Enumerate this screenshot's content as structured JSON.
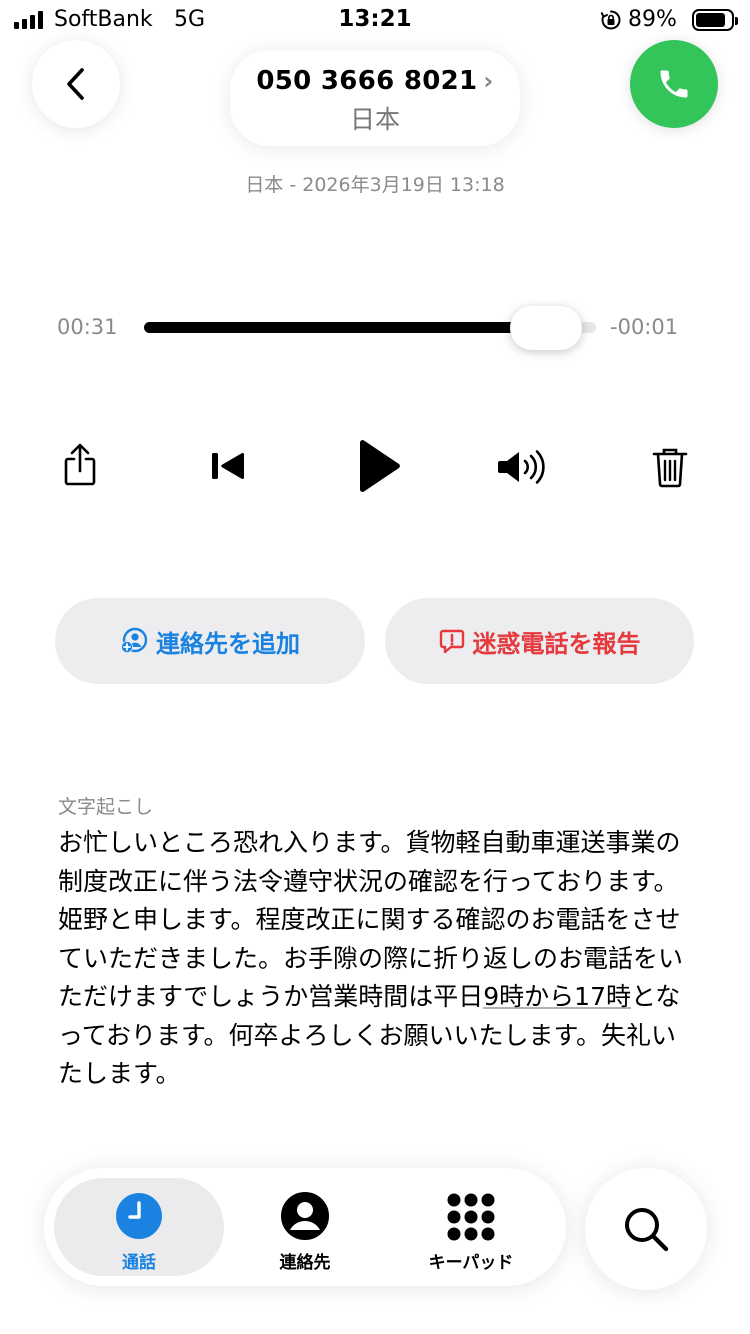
{
  "status_bar": {
    "carrier": "SoftBank",
    "network": "5G",
    "time": "13:21",
    "battery_percent": "89%",
    "battery_level": 0.89
  },
  "header": {
    "caller_number": "050 3666 8021",
    "caller_chevron": "›",
    "caller_country": "日本",
    "call_meta": "日本 - 2026年3月19日 13:18",
    "back_icon": "chevron-left-icon",
    "call_icon": "phone-icon",
    "call_button_color": "#33c45a"
  },
  "player": {
    "elapsed": "00:31",
    "remaining": "-00:01",
    "progress": 0.97,
    "icons": [
      "share-icon",
      "skip-back-icon",
      "play-icon",
      "speaker-icon",
      "trash-icon"
    ]
  },
  "actions": {
    "add_contact": "連絡先を追加",
    "report_spam": "迷惑電話を報告",
    "add_color": "#1a82e0",
    "spam_color": "#e5393d"
  },
  "transcript": {
    "label": "文字起こし",
    "text_a": "お忙しいところ恐れ入ります。貨物軽自動車運送事業の制度改正に伴う法令遵守状況の確認を行っております。姫野と申します。程度改正に関する確認のお電話をさせていただきました。お手隙の際に折り返しのお電話をいただけますでしょうか営業時間は平日",
    "text_link": "9時から17時",
    "text_b": "となっております。何卒よろしくお願いいたします。失礼いたします。"
  },
  "tabbar": {
    "tabs": [
      {
        "label": "通話",
        "icon": "clock-icon",
        "active": true
      },
      {
        "label": "連絡先",
        "icon": "person-circle-icon",
        "active": false
      },
      {
        "label": "キーパッド",
        "icon": "keypad-icon",
        "active": false
      }
    ],
    "search_icon": "search-icon",
    "accent": "#1a82e0"
  }
}
